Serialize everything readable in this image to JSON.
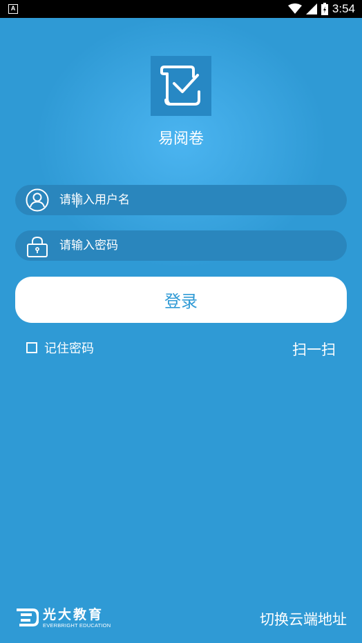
{
  "status_bar": {
    "notification_icon": "A",
    "time": "3:54",
    "icons": [
      "wifi-icon",
      "signal-icon",
      "battery-icon"
    ]
  },
  "app": {
    "title": "易阅卷",
    "logo_icon": "document-check-icon"
  },
  "form": {
    "username_placeholder": "请输入用户名",
    "password_placeholder": "请输入密码",
    "login_label": "登录",
    "remember_label": "记住密码",
    "remember_checked": false,
    "scan_label": "扫一扫"
  },
  "footer": {
    "brand_cn": "光大教育",
    "brand_en": "EVERBRIGHT EDUCATION",
    "switch_label": "切换云端地址"
  },
  "colors": {
    "background": "#2f9ad5",
    "field_bg": "#2a86bd",
    "button_bg": "#ffffff",
    "button_text": "#2f9ad5"
  }
}
